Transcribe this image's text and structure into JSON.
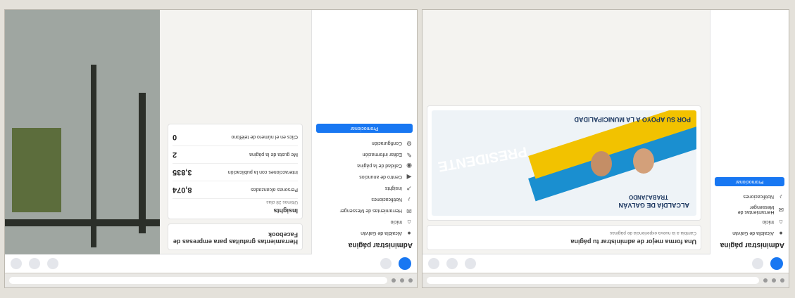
{
  "shots": [
    {
      "id": "left",
      "browser": {
        "url": ""
      },
      "sidebar": {
        "title": "Administrar página",
        "items": [
          {
            "label": "Alcaldía de Galván",
            "icon": "avatar"
          },
          {
            "label": "Inicio",
            "icon": "home-icon"
          },
          {
            "label": "Herramientas de Messenger",
            "icon": "messenger-icon"
          },
          {
            "label": "Notificaciones",
            "icon": "bell-icon"
          }
        ],
        "button": "Promocionar"
      },
      "card": {
        "title": "Una forma mejor de administrar tu página",
        "note": "Cambia a la nueva experiencia de páginas"
      },
      "poster": {
        "line1": "ALCALDÍA DE GALVÁN",
        "line2": "TRABAJANDO",
        "word": "PRESIDENTE",
        "footer": "POR SU APOYO A LA MUNICIPALIDAD"
      }
    },
    {
      "id": "right",
      "browser": {
        "url": ""
      },
      "sidebar": {
        "title": "Administrar página",
        "items": [
          {
            "label": "Alcaldía de Galván",
            "icon": "avatar"
          },
          {
            "label": "Inicio",
            "icon": "home-icon"
          },
          {
            "label": "Herramientas de Messenger",
            "icon": "messenger-icon"
          },
          {
            "label": "Notificaciones",
            "icon": "bell-icon"
          },
          {
            "label": "Insights",
            "icon": "chart-icon"
          },
          {
            "label": "Centro de anuncios",
            "icon": "megaphone-icon"
          },
          {
            "label": "Calidad de la página",
            "icon": "shield-icon"
          },
          {
            "label": "Editar información",
            "icon": "pencil-icon"
          },
          {
            "label": "Configuración",
            "icon": "gear-icon"
          }
        ],
        "button": "Promocionar"
      },
      "tools": {
        "title": "Herramientas gratuitas para empresas de Facebook"
      },
      "insights": {
        "title": "Insights",
        "range": "Últimos 28 días",
        "rows": [
          {
            "label": "Personas alcanzadas",
            "value": "8,074"
          },
          {
            "label": "Interacciones con la publicación",
            "value": "3,835"
          },
          {
            "label": "Me gusta de la página",
            "value": "2"
          },
          {
            "label": "Clics en el número de teléfono",
            "value": "0"
          }
        ]
      }
    }
  ]
}
